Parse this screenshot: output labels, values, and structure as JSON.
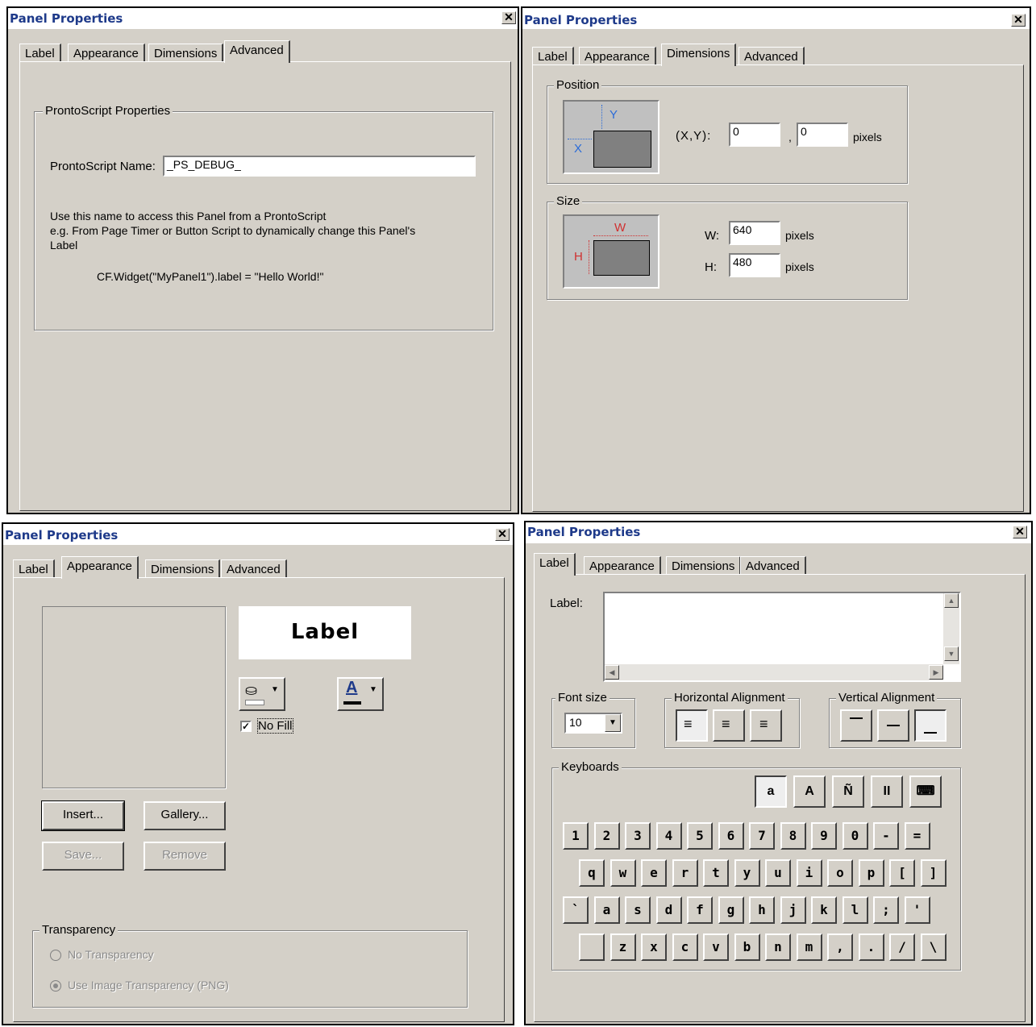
{
  "dialog_title": "Panel Properties",
  "close_glyph": "✕",
  "tabs": [
    "Label",
    "Appearance",
    "Dimensions",
    "Advanced"
  ],
  "advanced": {
    "group_title": "ProntoScript Properties",
    "name_label": "ProntoScript Name:",
    "name_value": "_PS_DEBUG_",
    "help_line1": "Use this name to access this Panel from a ProntoScript",
    "help_line2": "e.g. From Page Timer or Button Script to dynamically  change this Panel's",
    "help_line3": "Label",
    "code_example": "CF.Widget(\"MyPanel1\").label = \"Hello World!\""
  },
  "dimensions": {
    "position_title": "Position",
    "xy_label": "(X,Y):",
    "x_value": "0",
    "comma": ",",
    "y_value": "0",
    "pixels": "pixels",
    "size_title": "Size",
    "w_label": "W:",
    "w_value": "640",
    "h_label": "H:",
    "h_value": "480",
    "diagram_x": "X",
    "diagram_y": "Y",
    "diagram_w": "W",
    "diagram_h": "H"
  },
  "appearance": {
    "preview_label": "Label",
    "no_fill_label": "No Fill",
    "no_fill_checked": true,
    "insert_btn": "Insert...",
    "gallery_btn": "Gallery...",
    "save_btn": "Save...",
    "remove_btn": "Remove",
    "transparency_title": "Transparency",
    "no_transparency": "No Transparency",
    "use_image_transparency": "Use Image Transparency (PNG)",
    "font_color_glyph": "A"
  },
  "label_tab": {
    "label_caption": "Label:",
    "label_value": "",
    "font_size_title": "Font size",
    "font_size_value": "10",
    "halign_title": "Horizontal Alignment",
    "valign_title": "Vertical Alignment",
    "keyboards_title": "Keyboards",
    "keyboard_modes": [
      "a",
      "A",
      "Ñ",
      "II",
      "⌨"
    ],
    "row1": [
      "1",
      "2",
      "3",
      "4",
      "5",
      "6",
      "7",
      "8",
      "9",
      "0",
      "-",
      "="
    ],
    "row2": [
      "q",
      "w",
      "e",
      "r",
      "t",
      "y",
      "u",
      "i",
      "o",
      "p",
      "[",
      "]"
    ],
    "row3": [
      "`",
      "a",
      "s",
      "d",
      "f",
      "g",
      "h",
      "j",
      "k",
      "l",
      ";",
      "'"
    ],
    "row4": [
      "",
      "z",
      "x",
      "c",
      "v",
      "b",
      "n",
      "m",
      ",",
      ".",
      "/",
      "\\"
    ]
  }
}
